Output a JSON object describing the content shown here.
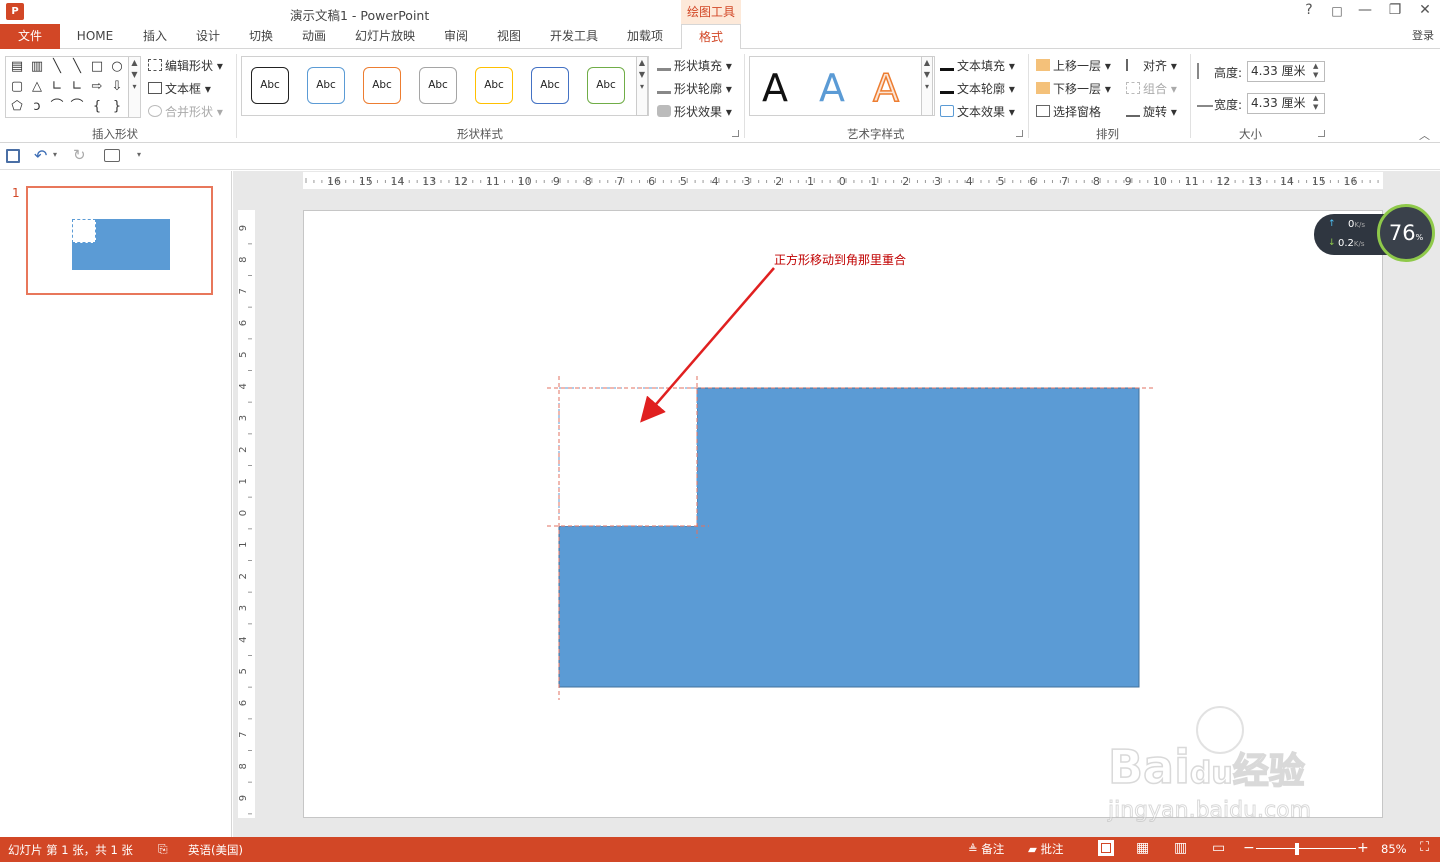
{
  "titlebar": {
    "app_icon": "P",
    "title": "演示文稿1 - PowerPoint",
    "contextual": "绘图工具",
    "help": "?",
    "restore_ribbon": "□",
    "minimize": "—",
    "maximize": "❐",
    "close": "✕"
  },
  "tabs": {
    "file": "文件",
    "home": "HOME",
    "insert": "插入",
    "design": "设计",
    "transitions": "切换",
    "animations": "动画",
    "slideshow": "幻灯片放映",
    "review": "审阅",
    "view": "视图",
    "developer": "开发工具",
    "addins": "加载项",
    "format": "格式",
    "login": "登录"
  },
  "ribbon": {
    "insert_shapes": {
      "label": "插入形状",
      "edit_shape": "编辑形状",
      "textbox": "文本框",
      "merge_shapes": "合并形状",
      "shape_glyphs": [
        "▤",
        "▥",
        "╲",
        "╲",
        "□",
        "○",
        "▢",
        "△",
        "∟",
        "∟",
        "⇨",
        "⇩",
        "⬠",
        "ↄ",
        "⌒",
        "⌒",
        "{",
        "}"
      ]
    },
    "shape_styles": {
      "label": "形状样式",
      "swatch_text": "Abc",
      "swatches": [
        {
          "border": "#222222"
        },
        {
          "border": "#5b9bd5"
        },
        {
          "border": "#ed7d31"
        },
        {
          "border": "#a5a5a5"
        },
        {
          "border": "#ffc000"
        },
        {
          "border": "#4472c4"
        },
        {
          "border": "#70ad47"
        }
      ],
      "fill": "形状填充",
      "outline": "形状轮廓",
      "effects": "形状效果"
    },
    "wordart": {
      "label": "艺术字样式",
      "letters": [
        "A",
        "A",
        "A"
      ],
      "text_fill": "文本填充",
      "text_outline": "文本轮廓",
      "text_effects": "文本效果"
    },
    "arrange": {
      "label": "排列",
      "bring_forward": "上移一层",
      "send_backward": "下移一层",
      "selection_pane": "选择窗格",
      "align": "对齐",
      "group": "组合",
      "rotate": "旋转"
    },
    "size": {
      "label": "大小",
      "height_label": "高度:",
      "height_value": "4.33 厘米",
      "width_label": "宽度:",
      "width_value": "4.33 厘米"
    }
  },
  "qat": {
    "save": "save-icon",
    "undo": "undo-icon",
    "redo": "redo-icon",
    "present": "present-icon"
  },
  "thumbnails": [
    {
      "number": "1"
    }
  ],
  "ruler": {
    "h_labels": [
      "16",
      "15",
      "14",
      "13",
      "12",
      "11",
      "10",
      "9",
      "8",
      "7",
      "6",
      "5",
      "4",
      "3",
      "2",
      "1",
      "0",
      "1",
      "2",
      "3",
      "4",
      "5",
      "6",
      "7",
      "8",
      "9",
      "10",
      "11",
      "12",
      "13",
      "14",
      "15",
      "16"
    ],
    "v_labels": [
      "9",
      "8",
      "7",
      "6",
      "5",
      "4",
      "3",
      "2",
      "1",
      "0",
      "1",
      "2",
      "3",
      "4",
      "5",
      "6",
      "7",
      "8",
      "9"
    ]
  },
  "slide": {
    "annotation": "正方形移动到角那里重合",
    "rect_color": "#5b9bd5",
    "arrow_color": "#e02020"
  },
  "netwidget": {
    "up": "0",
    "up_unit": "K/s",
    "down": "0.2",
    "down_unit": "K/s",
    "percent": "76",
    "percent_unit": "%"
  },
  "statusbar": {
    "slide_info": "幻灯片 第 1 张，共 1 张",
    "language": "英语(美国)",
    "notes": "备注",
    "comments": "批注",
    "zoom": "85%"
  },
  "watermark": {
    "brand_latin": "Bai",
    "brand_du": "du",
    "brand_cn": "经验",
    "url": "jingyan.baidu.com"
  }
}
